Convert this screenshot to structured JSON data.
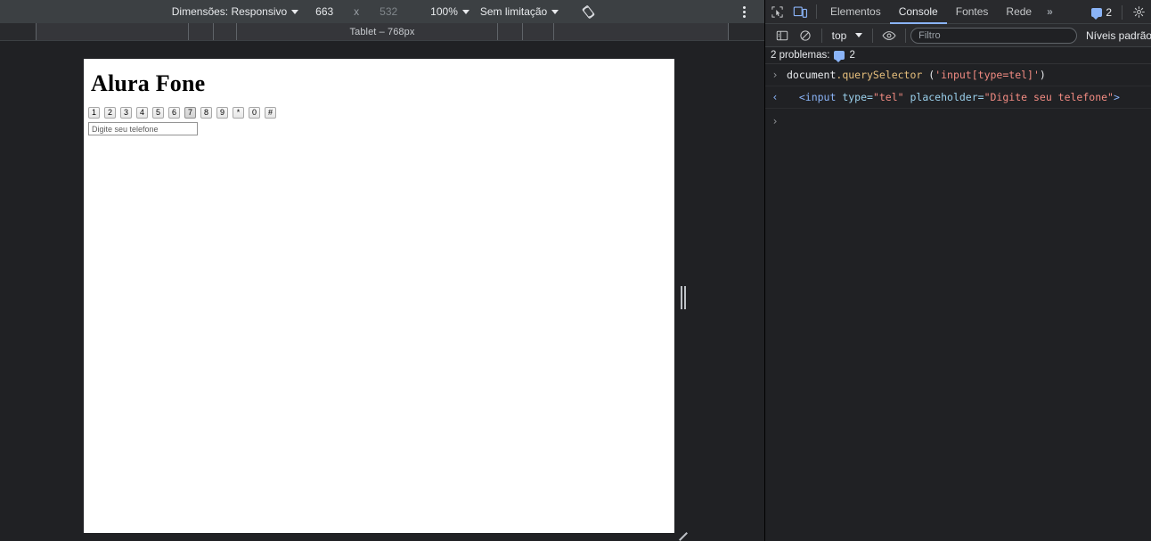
{
  "device_toolbar": {
    "dimensions_label": "Dimensões: Responsivo",
    "width_value": "663",
    "x_separator": "x",
    "height_value": "532",
    "zoom_label": "100%",
    "throttling_label": "Sem limitação",
    "rotate_icon": "rotate-icon",
    "more_icon": "three-dots-vertical-icon"
  },
  "ruler": {
    "label": "Tablet – 768px"
  },
  "page": {
    "title": "Alura Fone",
    "keypad_keys": [
      "1",
      "2",
      "3",
      "4",
      "5",
      "6",
      "7",
      "8",
      "9",
      "*",
      "0",
      "#"
    ],
    "active_key": "7",
    "phone_input_value": "",
    "phone_input_placeholder": "Digite seu telefone"
  },
  "devtools": {
    "inspect_icon": "inspect-element-icon",
    "device_toggle_icon": "device-toolbar-icon",
    "tabs": [
      {
        "label": "Elementos",
        "active": false
      },
      {
        "label": "Console",
        "active": true
      },
      {
        "label": "Fontes",
        "active": false
      },
      {
        "label": "Rede",
        "active": false
      }
    ],
    "overflow_label": "»",
    "issues_badge_count": "2",
    "settings_icon": "gear-icon",
    "console_toolbar": {
      "sidebar_icon": "console-sidebar-icon",
      "clear_icon": "clear-console-icon",
      "context": "top",
      "eye_icon": "live-expression-eye-icon",
      "filter_placeholder": "Filtro",
      "filter_value": "",
      "levels_label": "Níveis padrão"
    },
    "issues_strip": {
      "text": "2 problemas:",
      "count": "2",
      "icon": "message-chip-icon"
    },
    "console_rows": [
      {
        "gutter": "›",
        "type": "input",
        "tokens": [
          {
            "t": "document",
            "c": "tok-plain"
          },
          {
            "t": ".querySelector",
            "c": "tok-prop"
          },
          {
            "t": " (",
            "c": "tok-plain"
          },
          {
            "t": "'input[type=tel]'",
            "c": "tok-str"
          },
          {
            "t": ")",
            "c": "tok-plain"
          }
        ]
      },
      {
        "gutter": "‹",
        "type": "output",
        "tokens": [
          {
            "t": "  <input",
            "c": "tok-tag"
          },
          {
            "t": " type=",
            "c": "tok-attr"
          },
          {
            "t": "\"tel\"",
            "c": "tok-val"
          },
          {
            "t": " placeholder=",
            "c": "tok-attr"
          },
          {
            "t": "\"Digite seu telefone\"",
            "c": "tok-val"
          },
          {
            "t": ">",
            "c": "tok-tag"
          }
        ]
      },
      {
        "gutter": "›",
        "type": "prompt",
        "tokens": []
      }
    ]
  },
  "colors": {
    "accent": "#8ab4f8",
    "toolbar_bg": "#3c4043",
    "panel_bg": "#202124",
    "tabbar_bg": "#292a2d"
  }
}
